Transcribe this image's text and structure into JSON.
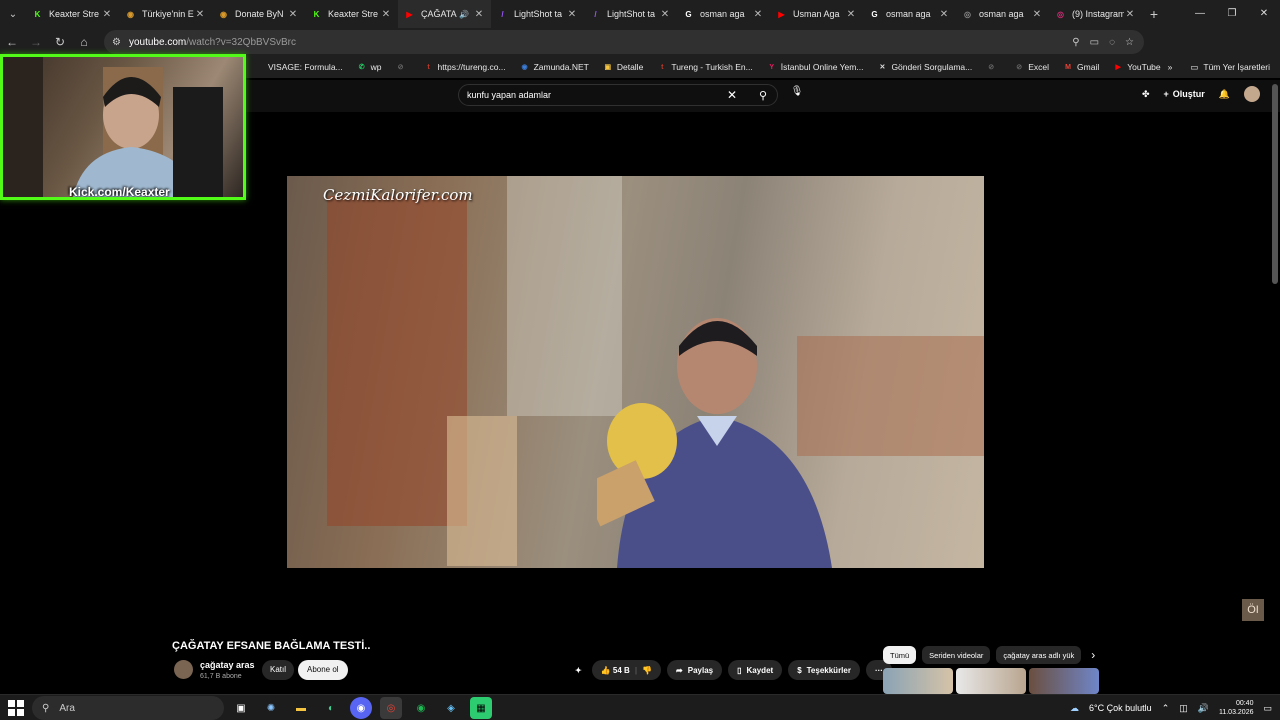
{
  "browser": {
    "tabs": [
      {
        "label": "Keaxter Stre",
        "favicon_color": "#53fc18",
        "favicon_glyph": "K"
      },
      {
        "label": "Türkiye'nin E",
        "favicon_color": "#d99a2b",
        "favicon_glyph": "◉"
      },
      {
        "label": "Donate ByN",
        "favicon_color": "#d99a2b",
        "favicon_glyph": "◉"
      },
      {
        "label": "Keaxter Stre",
        "favicon_color": "#53fc18",
        "favicon_glyph": "K"
      },
      {
        "label": "ÇAĞATA",
        "favicon_color": "#ff0000",
        "favicon_glyph": "▶",
        "audio": "🔊"
      },
      {
        "label": "LightShot ta",
        "favicon_color": "#9b59ff",
        "favicon_glyph": "/"
      },
      {
        "label": "LightShot ta",
        "favicon_color": "#9b59ff",
        "favicon_glyph": "/"
      },
      {
        "label": "osman aga",
        "favicon_color": "#ffffff",
        "favicon_glyph": "G"
      },
      {
        "label": "Usman Aga",
        "favicon_color": "#ff0000",
        "favicon_glyph": "▶"
      },
      {
        "label": "osman aga",
        "favicon_color": "#ffffff",
        "favicon_glyph": "G"
      },
      {
        "label": "osman aga",
        "favicon_color": "#888888",
        "favicon_glyph": "◎"
      },
      {
        "label": "(9) Instagram",
        "favicon_color": "#d62976",
        "favicon_glyph": "◎"
      }
    ],
    "url_site": "youtube.com",
    "url_path": "/watch?v=32QbBVSvBrc",
    "bookmarks": [
      {
        "label": "VISAGE: Formula...",
        "color": "#888888",
        "glyph": ""
      },
      {
        "label": "wp",
        "color": "#25d366",
        "glyph": "✆"
      },
      {
        "label": "",
        "color": "#666666",
        "glyph": "⊘"
      },
      {
        "label": "https://tureng.co...",
        "color": "#c0392b",
        "glyph": "t"
      },
      {
        "label": "Zamunda.NET",
        "color": "#3a7bd5",
        "glyph": "◉"
      },
      {
        "label": "Detalle",
        "color": "#f4c542",
        "glyph": "▣"
      },
      {
        "label": "Tureng - Turkish En...",
        "color": "#c0392b",
        "glyph": "t"
      },
      {
        "label": "İstanbul Online Yem...",
        "color": "#e91e63",
        "glyph": "Y"
      },
      {
        "label": "Gönderi Sorgulama...",
        "color": "#dddddd",
        "glyph": "✕"
      },
      {
        "label": "",
        "color": "#666666",
        "glyph": "⊘"
      },
      {
        "label": "Excel",
        "color": "#666666",
        "glyph": "⊘"
      },
      {
        "label": "Gmail",
        "color": "#ea4335",
        "glyph": "M"
      },
      {
        "label": "YouTube",
        "color": "#ff0000",
        "glyph": "▶"
      }
    ],
    "all_bookmarks_label": "Tüm Yer İşaretleri"
  },
  "youtube": {
    "search_value": "kunfu yapan adamlar",
    "create_label": "Oluştur",
    "video_watermark": "CezmiKalorifer.com",
    "corner_logo": "ÖI",
    "title": "ÇAĞATAY EFSANE BAĞLAMA TESTİ..",
    "channel_name": "çağatay aras",
    "channel_subs": "61,7 B abone",
    "join_label": "Katıl",
    "subscribe_label": "Abone ol",
    "likes": "54 B",
    "share_label": "Paylaş",
    "save_label": "Kaydet",
    "thanks_label": "Teşekkürler",
    "chips": [
      "Tümü",
      "Seriden videolar",
      "çağatay aras adlı yük"
    ]
  },
  "stream": {
    "kick_label": "Kick.com/Keaxter"
  },
  "taskbar": {
    "search_placeholder": "Ara",
    "weather": "6°C  Çok bulutlu",
    "time": "00:40",
    "date": "11.03.2026"
  }
}
